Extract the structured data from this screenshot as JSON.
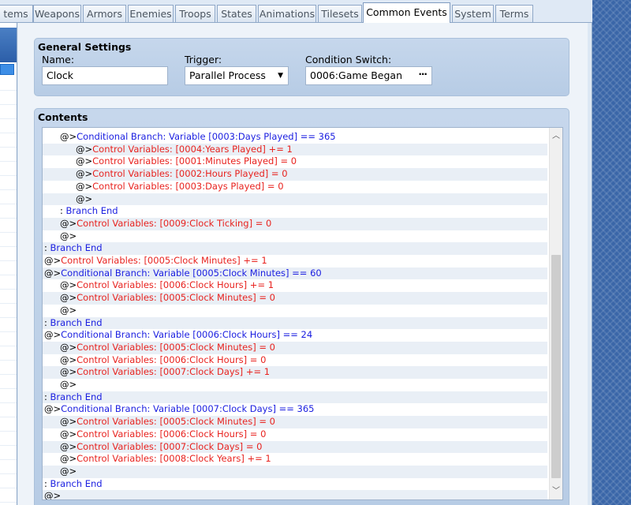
{
  "tabs": [
    {
      "label": "tems",
      "active": false
    },
    {
      "label": "Weapons",
      "active": false
    },
    {
      "label": "Armors",
      "active": false
    },
    {
      "label": "Enemies",
      "active": false
    },
    {
      "label": "Troops",
      "active": false
    },
    {
      "label": "States",
      "active": false
    },
    {
      "label": "Animations",
      "active": false
    },
    {
      "label": "Tilesets",
      "active": false
    },
    {
      "label": "Common Events",
      "active": true
    },
    {
      "label": "System",
      "active": false
    },
    {
      "label": "Terms",
      "active": false
    }
  ],
  "general": {
    "title": "General Settings",
    "name_label": "Name:",
    "name_value": "Clock",
    "trigger_label": "Trigger:",
    "trigger_value": "Parallel Process",
    "switch_label": "Condition Switch:",
    "switch_value": "0006:Game Began",
    "switch_button": "···"
  },
  "contents": {
    "title": "Contents",
    "commands": [
      {
        "indent": 2,
        "prefix": "@>",
        "text": "Conditional Branch: Variable [0003:Days Played] == 365",
        "color": "blue"
      },
      {
        "indent": 3,
        "prefix": "@>",
        "text": "Control Variables: [0004:Years Played] += 1",
        "color": "red"
      },
      {
        "indent": 3,
        "prefix": "@>",
        "text": "Control Variables: [0001:Minutes Played] = 0",
        "color": "red"
      },
      {
        "indent": 3,
        "prefix": "@>",
        "text": "Control Variables: [0002:Hours Played] = 0",
        "color": "red"
      },
      {
        "indent": 3,
        "prefix": "@>",
        "text": "Control Variables: [0003:Days Played] = 0",
        "color": "red"
      },
      {
        "indent": 3,
        "prefix": "@>",
        "text": "",
        "color": "black"
      },
      {
        "indent": 2,
        "prefix": " : ",
        "text": "Branch End",
        "color": "blue"
      },
      {
        "indent": 2,
        "prefix": "@>",
        "text": "Control Variables: [0009:Clock Ticking] = 0",
        "color": "red"
      },
      {
        "indent": 2,
        "prefix": "@>",
        "text": "",
        "color": "black"
      },
      {
        "indent": 1,
        "prefix": " : ",
        "text": "Branch End",
        "color": "blue"
      },
      {
        "indent": 1,
        "prefix": "@>",
        "text": "Control Variables: [0005:Clock Minutes] += 1",
        "color": "red"
      },
      {
        "indent": 1,
        "prefix": "@>",
        "text": "Conditional Branch: Variable [0005:Clock Minutes] == 60",
        "color": "blue"
      },
      {
        "indent": 2,
        "prefix": "@>",
        "text": "Control Variables: [0006:Clock Hours] += 1",
        "color": "red"
      },
      {
        "indent": 2,
        "prefix": "@>",
        "text": "Control Variables: [0005:Clock Minutes] = 0",
        "color": "red"
      },
      {
        "indent": 2,
        "prefix": "@>",
        "text": "",
        "color": "black"
      },
      {
        "indent": 1,
        "prefix": " : ",
        "text": "Branch End",
        "color": "blue"
      },
      {
        "indent": 1,
        "prefix": "@>",
        "text": "Conditional Branch: Variable [0006:Clock Hours] == 24",
        "color": "blue"
      },
      {
        "indent": 2,
        "prefix": "@>",
        "text": "Control Variables: [0005:Clock Minutes] = 0",
        "color": "red"
      },
      {
        "indent": 2,
        "prefix": "@>",
        "text": "Control Variables: [0006:Clock Hours] = 0",
        "color": "red"
      },
      {
        "indent": 2,
        "prefix": "@>",
        "text": "Control Variables: [0007:Clock Days] += 1",
        "color": "red"
      },
      {
        "indent": 2,
        "prefix": "@>",
        "text": "",
        "color": "black"
      },
      {
        "indent": 1,
        "prefix": " : ",
        "text": "Branch End",
        "color": "blue"
      },
      {
        "indent": 1,
        "prefix": "@>",
        "text": "Conditional Branch: Variable [0007:Clock Days] == 365",
        "color": "blue"
      },
      {
        "indent": 2,
        "prefix": "@>",
        "text": "Control Variables: [0005:Clock Minutes] = 0",
        "color": "red"
      },
      {
        "indent": 2,
        "prefix": "@>",
        "text": "Control Variables: [0006:Clock Hours] = 0",
        "color": "red"
      },
      {
        "indent": 2,
        "prefix": "@>",
        "text": "Control Variables: [0007:Clock Days] = 0",
        "color": "red"
      },
      {
        "indent": 2,
        "prefix": "@>",
        "text": "Control Variables: [0008:Clock Years] += 1",
        "color": "red"
      },
      {
        "indent": 2,
        "prefix": "@>",
        "text": "",
        "color": "black"
      },
      {
        "indent": 1,
        "prefix": " : ",
        "text": "Branch End",
        "color": "blue"
      },
      {
        "indent": 1,
        "prefix": "@>",
        "text": "",
        "color": "black"
      }
    ]
  },
  "scrollbar": {
    "up_icon": "chevron-up-icon",
    "down_icon": "chevron-down-icon"
  }
}
